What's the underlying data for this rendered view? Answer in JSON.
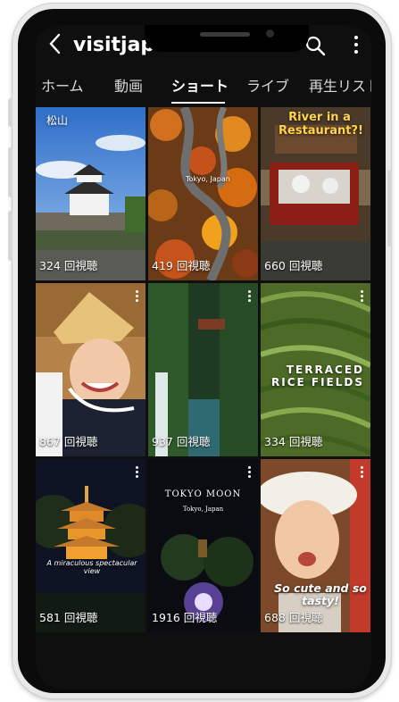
{
  "app": {
    "title": "visitjapan",
    "back_icon": "back-arrow-icon",
    "search_icon": "search-icon",
    "more_icon": "more-vert-icon"
  },
  "tabs": [
    {
      "label": "ホーム"
    },
    {
      "label": "動画"
    },
    {
      "label": "ショート",
      "active": true
    },
    {
      "label": "ライブ"
    },
    {
      "label": "再生リスト"
    }
  ],
  "shorts": [
    {
      "views": "324 回視聴",
      "overlay": "",
      "theme": "castle"
    },
    {
      "views": "419 回視聴",
      "overlay": "Tokyo, Japan",
      "theme": "autumn-road"
    },
    {
      "views": "660 回視聴",
      "overlay": "River in a Restaurant?!",
      "theme": "river-restaurant"
    },
    {
      "views": "867 回視聴",
      "overlay": "",
      "theme": "dancer"
    },
    {
      "views": "937 回視聴",
      "overlay": "",
      "theme": "gorge"
    },
    {
      "views": "334 回視聴",
      "overlay": "TERRACED RICE FIELDS",
      "theme": "terraces"
    },
    {
      "views": "581 回視聴",
      "overlay": "A miraculous spectacular view",
      "theme": "pagoda"
    },
    {
      "views": "1916 回視聴",
      "overlay": "TOKYO MOON",
      "sub": "Tokyo, Japan",
      "theme": "tokyo-moon"
    },
    {
      "views": "688 回視聴",
      "overlay": "So cute and so tasty!",
      "theme": "food"
    }
  ],
  "colors": {
    "background": "#0f0f0f",
    "text": "#ffffff",
    "tab_inactive": "#d9d9d9"
  }
}
